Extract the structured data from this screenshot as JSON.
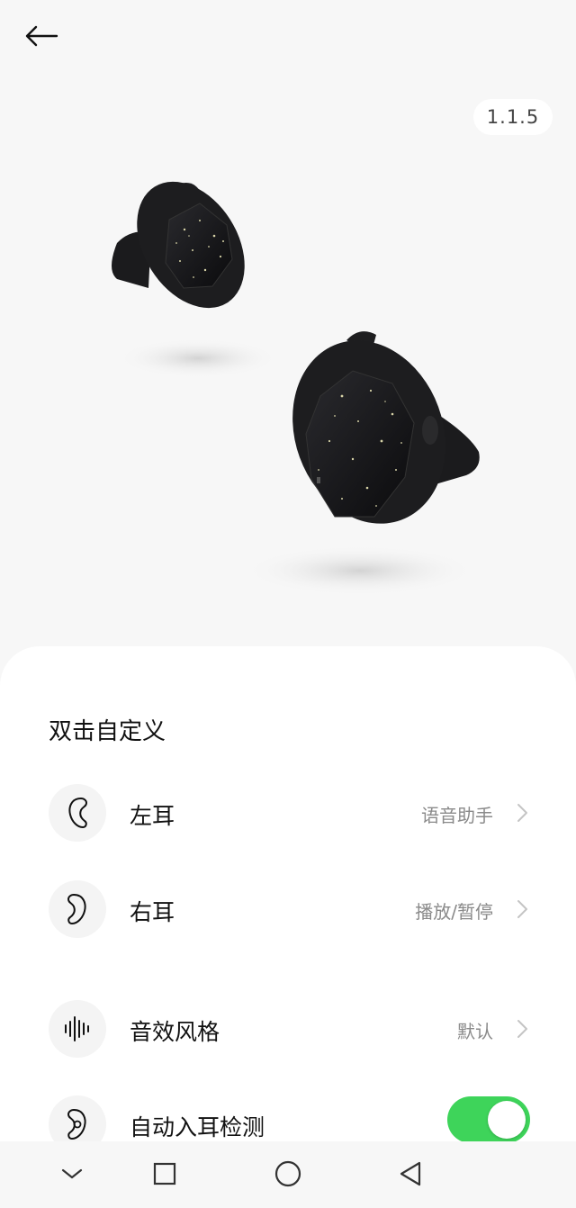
{
  "header": {
    "back_icon": "arrow-left-icon",
    "version": "1.1.5"
  },
  "hero": {
    "image": "earbuds-product-image"
  },
  "double_tap": {
    "title": "双击自定义",
    "left_ear": {
      "label": "左耳",
      "value": "语音助手",
      "icon": "ear-left-icon"
    },
    "right_ear": {
      "label": "右耳",
      "value": "播放/暂停",
      "icon": "ear-right-icon"
    }
  },
  "sound_style": {
    "label": "音效风格",
    "value": "默认",
    "icon": "sound-wave-icon"
  },
  "auto_ear_detect": {
    "label": "自动入耳检测",
    "icon": "ear-detect-icon",
    "enabled": true
  },
  "colors": {
    "toggle_on": "#3ed45a",
    "value_text": "#8a8a8a"
  },
  "navbar": {
    "items": [
      "chevron-down-icon",
      "recents-square-icon",
      "home-circle-icon",
      "back-triangle-icon"
    ]
  }
}
